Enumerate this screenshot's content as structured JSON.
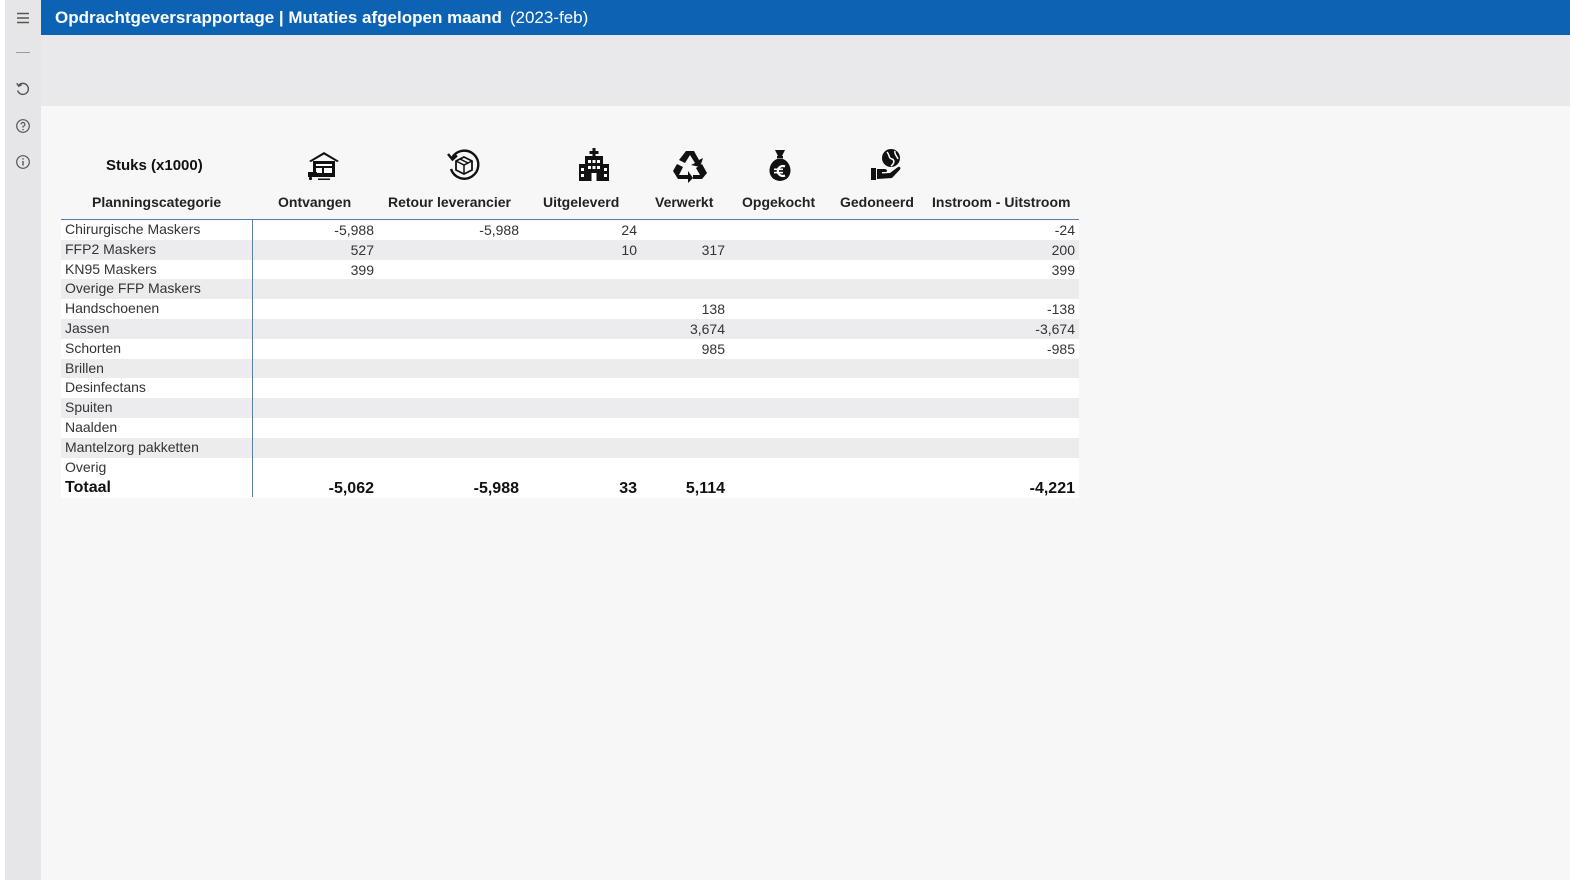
{
  "app": {
    "title": "Opdrachtgeversrapportage | Mutaties afgelopen maand",
    "period": "(2023-feb)"
  },
  "sidebar": {
    "items": [
      {
        "icon": "menu-icon"
      },
      {
        "icon": "undo-icon"
      },
      {
        "icon": "help-icon"
      },
      {
        "icon": "info-icon"
      }
    ]
  },
  "report": {
    "unit_label": "Stuks (x1000)",
    "category_header": "Planningscategorie",
    "columns": [
      {
        "label": "Ontvangen",
        "icon": "warehouse-inflow-icon"
      },
      {
        "label": "Retour leverancier",
        "icon": "return-box-icon"
      },
      {
        "label": "Uitgeleverd",
        "icon": "hospital-icon"
      },
      {
        "label": "Verwerkt",
        "icon": "recycle-icon"
      },
      {
        "label": "Opgekocht",
        "icon": "money-bag-euro-icon"
      },
      {
        "label": "Gedoneerd",
        "icon": "donation-hand-icon"
      },
      {
        "label": "Instroom - Uitstroom",
        "icon": ""
      }
    ],
    "rows": [
      {
        "category": "Chirurgische Maskers",
        "ontvangen": "-5,988",
        "retour": "-5,988",
        "uitgeleverd": "24",
        "verwerkt": "",
        "saldo": "-24"
      },
      {
        "category": "FFP2 Maskers",
        "ontvangen": "527",
        "retour": "",
        "uitgeleverd": "10",
        "verwerkt": "317",
        "saldo": "200"
      },
      {
        "category": "KN95 Maskers",
        "ontvangen": "399",
        "retour": "",
        "uitgeleverd": "",
        "verwerkt": "",
        "saldo": "399"
      },
      {
        "category": "Overige FFP Maskers",
        "ontvangen": "",
        "retour": "",
        "uitgeleverd": "",
        "verwerkt": "",
        "saldo": ""
      },
      {
        "category": "Handschoenen",
        "ontvangen": "",
        "retour": "",
        "uitgeleverd": "",
        "verwerkt": "138",
        "saldo": "-138"
      },
      {
        "category": "Jassen",
        "ontvangen": "",
        "retour": "",
        "uitgeleverd": "",
        "verwerkt": "3,674",
        "saldo": "-3,674"
      },
      {
        "category": "Schorten",
        "ontvangen": "",
        "retour": "",
        "uitgeleverd": "",
        "verwerkt": "985",
        "saldo": "-985"
      },
      {
        "category": "Brillen",
        "ontvangen": "",
        "retour": "",
        "uitgeleverd": "",
        "verwerkt": "",
        "saldo": ""
      },
      {
        "category": "Desinfectans",
        "ontvangen": "",
        "retour": "",
        "uitgeleverd": "",
        "verwerkt": "",
        "saldo": ""
      },
      {
        "category": "Spuiten",
        "ontvangen": "",
        "retour": "",
        "uitgeleverd": "",
        "verwerkt": "",
        "saldo": ""
      },
      {
        "category": "Naalden",
        "ontvangen": "",
        "retour": "",
        "uitgeleverd": "",
        "verwerkt": "",
        "saldo": ""
      },
      {
        "category": "Mantelzorg pakketten",
        "ontvangen": "",
        "retour": "",
        "uitgeleverd": "",
        "verwerkt": "",
        "saldo": ""
      },
      {
        "category": "Overig",
        "ontvangen": "",
        "retour": "",
        "uitgeleverd": "",
        "verwerkt": "",
        "saldo": ""
      }
    ],
    "total": {
      "category": "Totaal",
      "ontvangen": "-5,062",
      "retour": "-5,988",
      "uitgeleverd": "33",
      "verwerkt": "5,114",
      "saldo": "-4,221"
    }
  },
  "colors": {
    "title_bar": "#0c63b4",
    "rail": "#e6e6e8",
    "band": "#e9e9ec",
    "row_alt": "#ececee",
    "separator": "#5a7fa8"
  }
}
